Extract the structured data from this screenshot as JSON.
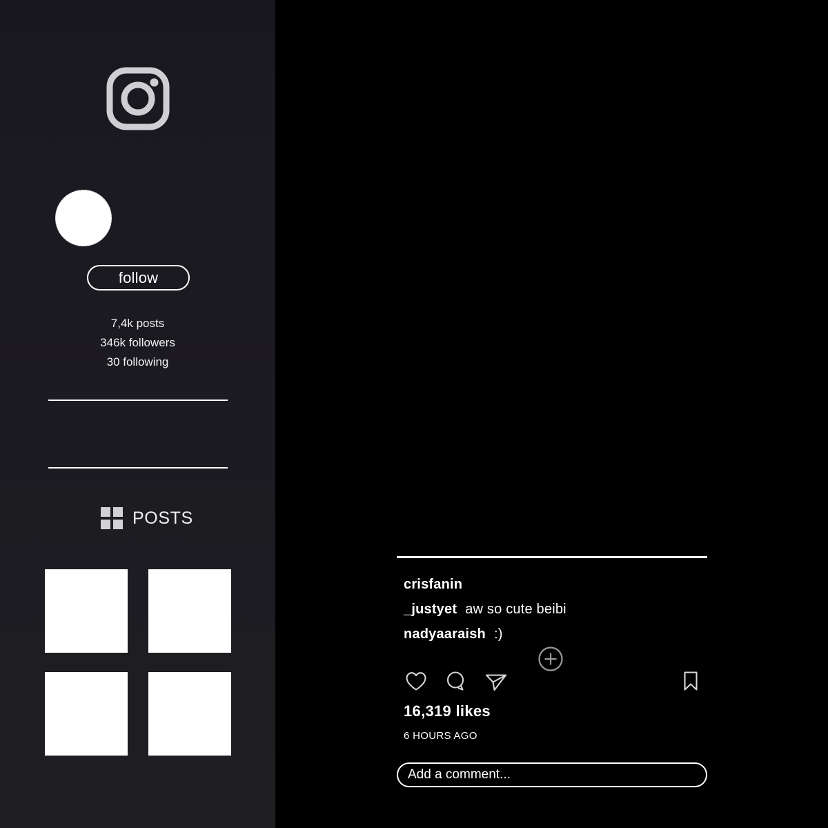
{
  "app": {
    "name": "Instagram",
    "logo_icon": "instagram-logo-icon",
    "background_color": "#000000",
    "sidebar_color": "#1b1a20",
    "accent_color": "#ffffff"
  },
  "sidebar": {
    "avatar": {
      "icon": "avatar-placeholder",
      "alt": ""
    },
    "follow_button": {
      "label": "follow"
    },
    "stats": {
      "posts": "7,4k posts",
      "followers": "346k followers",
      "following": "30 following"
    },
    "tabs": [
      {
        "label": "POSTS",
        "icon": "grid-icon",
        "selected": true
      }
    ],
    "post_thumbnails": [
      {
        "alt": ""
      },
      {
        "alt": ""
      },
      {
        "alt": ""
      },
      {
        "alt": ""
      }
    ]
  },
  "post": {
    "media": {
      "alt": ""
    },
    "comments": [
      {
        "username": "crisfanin",
        "text": ""
      },
      {
        "username": "_justyet",
        "text": "aw so cute beibi"
      },
      {
        "username": "nadyaaraish",
        "text": ":)"
      }
    ],
    "actions": {
      "like_icon": "heart-icon",
      "comment_icon": "comment-bubble-icon",
      "share_icon": "share-paper-plane-icon",
      "save_icon": "bookmark-icon",
      "add_icon": "plus-circle-icon"
    },
    "likes": "16,319 likes",
    "timestamp": "6 HOURS AGO",
    "add_comment": {
      "placeholder": "Add a comment...",
      "value": ""
    }
  }
}
